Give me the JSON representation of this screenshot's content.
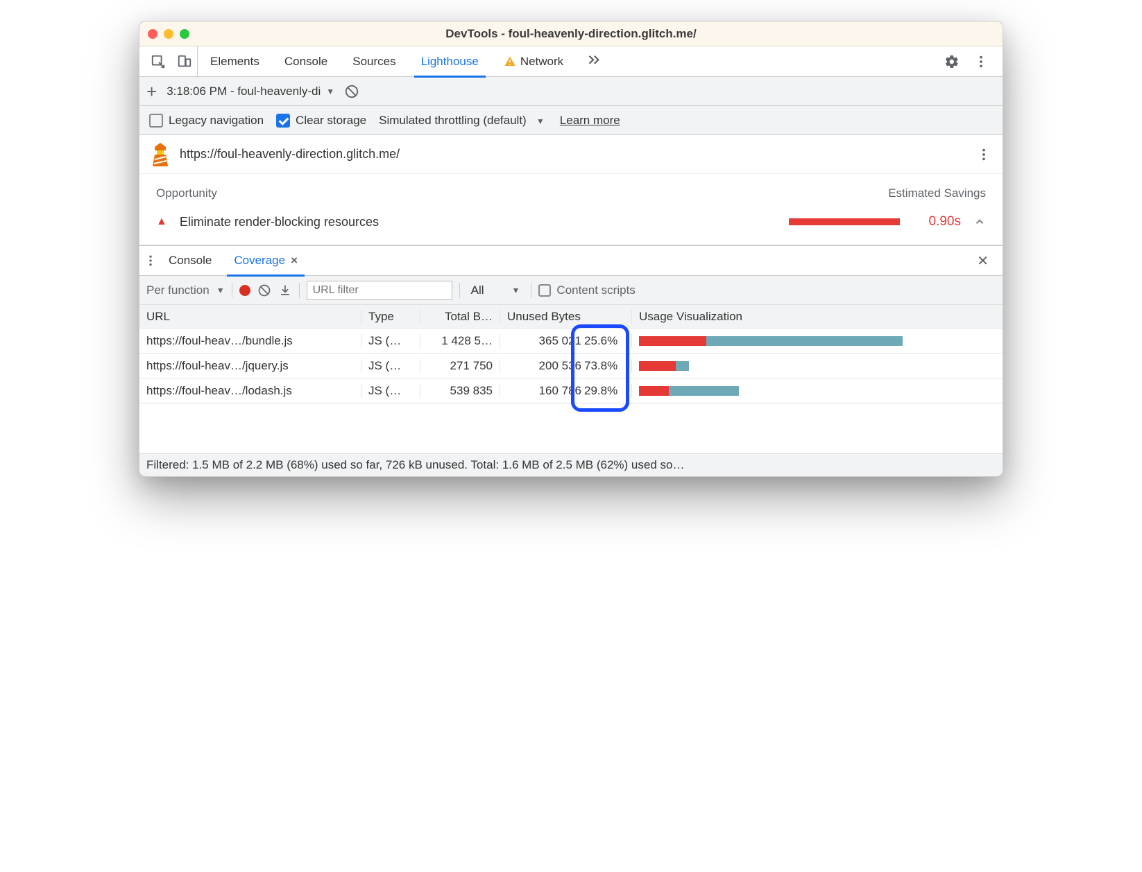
{
  "window": {
    "title": "DevTools - foul-heavenly-direction.glitch.me/"
  },
  "mainTabs": {
    "items": [
      "Elements",
      "Console",
      "Sources",
      "Lighthouse",
      "Network"
    ],
    "active": "Lighthouse",
    "networkWarning": true
  },
  "session": {
    "label": "3:18:06 PM - foul-heavenly-di"
  },
  "options": {
    "legacy_label": "Legacy navigation",
    "legacy_checked": false,
    "clear_label": "Clear storage",
    "clear_checked": true,
    "throttling_label": "Simulated throttling (default)",
    "learn_more": "Learn more"
  },
  "report": {
    "url": "https://foul-heavenly-direction.glitch.me/",
    "col_opportunity": "Opportunity",
    "col_savings": "Estimated Savings",
    "opportunity": {
      "title": "Eliminate render-blocking resources",
      "savings": "0.90s"
    }
  },
  "drawer": {
    "tabs": [
      "Console",
      "Coverage"
    ],
    "active": "Coverage"
  },
  "coverage": {
    "mode": "Per function",
    "filter_placeholder": "URL filter",
    "type_filter": "All",
    "content_scripts_label": "Content scripts",
    "cols": {
      "url": "URL",
      "type": "Type",
      "total": "Total B…",
      "unused": "Unused Bytes",
      "viz": "Usage Visualization"
    },
    "rows": [
      {
        "url": "https://foul-heav…/bundle.js",
        "type": "JS (…",
        "total": "1 428 5…",
        "unused_bytes": "365 021",
        "unused_pct": "25.6%",
        "pct_num": 25.6,
        "viz_total": 100
      },
      {
        "url": "https://foul-heav…/jquery.js",
        "type": "JS (…",
        "total": "271 750",
        "unused_bytes": "200 536",
        "unused_pct": "73.8%",
        "pct_num": 73.8,
        "viz_total": 19
      },
      {
        "url": "https://foul-heav…/lodash.js",
        "type": "JS (…",
        "total": "539 835",
        "unused_bytes": "160 786",
        "unused_pct": "29.8%",
        "pct_num": 29.8,
        "viz_total": 38
      }
    ],
    "footer": "Filtered: 1.5 MB of 2.2 MB (68%) used so far, 726 kB unused. Total: 1.6 MB of 2.5 MB (62%) used so…"
  }
}
